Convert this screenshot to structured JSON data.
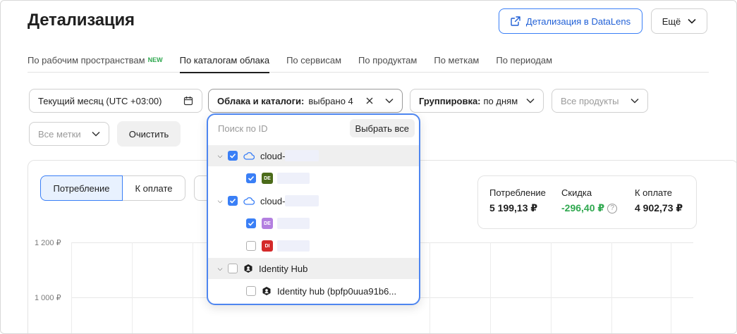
{
  "page": {
    "title": "Детализация",
    "datalens_button": "Детализация в DataLens",
    "more_button": "Ещё"
  },
  "tabs": [
    {
      "label": "По рабочим пространствам",
      "badge": "NEW",
      "active": false
    },
    {
      "label": "По каталогам облака",
      "active": true
    },
    {
      "label": "По сервисам",
      "active": false
    },
    {
      "label": "По продуктам",
      "active": false
    },
    {
      "label": "По меткам",
      "active": false
    },
    {
      "label": "По периодам",
      "active": false
    }
  ],
  "filters": {
    "period": "Текущий месяц (UTC +03:00)",
    "clouds_label": "Облака и каталоги:",
    "clouds_value": "выбрано 4",
    "grouping_label": "Группировка:",
    "grouping_value": "по дням",
    "products_placeholder": "Все продукты",
    "labels_placeholder": "Все метки",
    "clear_button": "Очистить"
  },
  "view_toggle": {
    "consumption": "Потребление",
    "to_pay": "К оплате"
  },
  "summary": {
    "consumption_label": "Потребление",
    "consumption_value": "5 199,13 ₽",
    "discount_label": "Скидка",
    "discount_value": "-296,40 ₽",
    "to_pay_label": "К оплате",
    "to_pay_value": "4 902,73 ₽"
  },
  "chart": {
    "y_ticks": [
      "1 200 ₽",
      "1 000 ₽"
    ]
  },
  "dropdown": {
    "search_placeholder": "Поиск по ID",
    "select_all": "Выбрать все",
    "items": [
      {
        "level": 0,
        "label": "cloud-",
        "checked": true,
        "icon": "cloud-icon"
      },
      {
        "level": 1,
        "badge": "DE",
        "badge_color": "#4b6b1a",
        "checked": true
      },
      {
        "level": 0,
        "label": "cloud-",
        "checked": true,
        "icon": "cloud-icon"
      },
      {
        "level": 1,
        "badge": "DE",
        "badge_color": "#b37fe0",
        "checked": true
      },
      {
        "level": 1,
        "badge": "DI",
        "badge_color": "#d42a2a",
        "checked": false
      },
      {
        "level": 0,
        "label": "Identity Hub",
        "checked": false,
        "icon": "identity-hub-icon"
      },
      {
        "level": 1,
        "label": "Identity hub (bpfp0uua91b6...",
        "checked": false,
        "icon": "identity-hub-icon"
      }
    ]
  },
  "colors": {
    "accent": "#3a7ff6",
    "positive": "#2fa84f"
  }
}
